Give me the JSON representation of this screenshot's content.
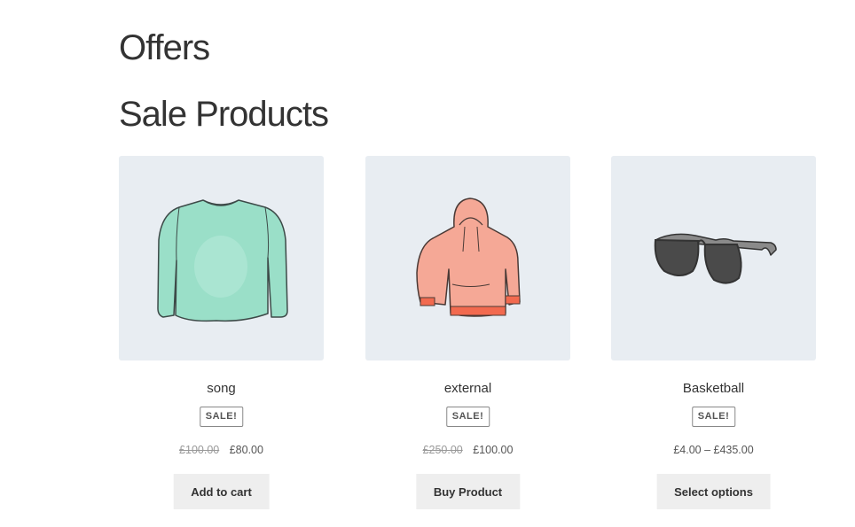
{
  "page": {
    "title": "Offers"
  },
  "section": {
    "title": "Sale Products"
  },
  "products": [
    {
      "name": "song",
      "badge": "SALE!",
      "regular_price": "£100.00",
      "sale_price": "£80.00",
      "button": "Add to cart",
      "image_icon": "long-sleeve-shirt-icon",
      "image_color": "#8fd9c0"
    },
    {
      "name": "external",
      "badge": "SALE!",
      "regular_price": "£250.00",
      "sale_price": "£100.00",
      "button": "Buy Product",
      "image_icon": "hoodie-icon",
      "image_color": "#f4a08b"
    },
    {
      "name": "Basketball",
      "badge": "SALE!",
      "price_range": "£4.00 – £435.00",
      "button": "Select options",
      "image_icon": "sunglasses-icon",
      "image_color": "#6f6f6f"
    }
  ],
  "colors": {
    "image_background": "#e8edf2",
    "button_background": "#eeeeee",
    "text": "#333333"
  }
}
